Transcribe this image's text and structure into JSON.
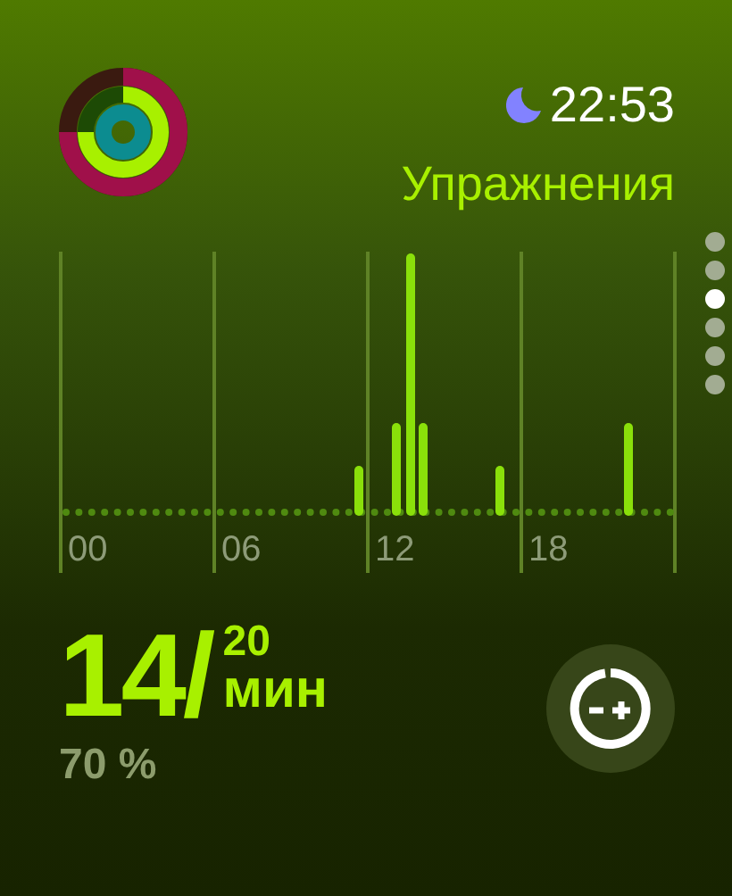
{
  "status": {
    "time": "22:53"
  },
  "title": "Упражнения",
  "chart": {
    "hour_labels": [
      "00",
      "06",
      "12",
      "18"
    ]
  },
  "page_dots": [
    {
      "selected": false
    },
    {
      "selected": false
    },
    {
      "selected": true
    },
    {
      "selected": false
    },
    {
      "selected": false
    },
    {
      "selected": false
    }
  ],
  "summary": {
    "current": "14/",
    "goal": "20",
    "unit": "мин",
    "percent": "70 %"
  }
}
